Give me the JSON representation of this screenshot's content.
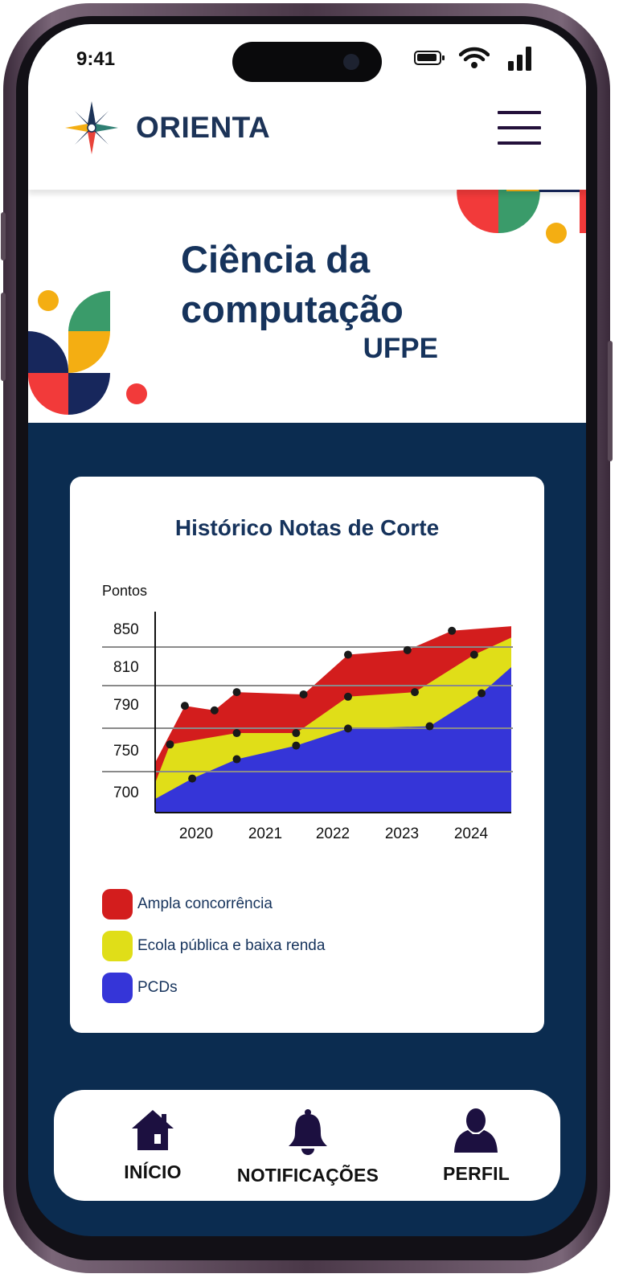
{
  "status_bar": {
    "time": "9:41"
  },
  "header": {
    "brand": "ORIENTA"
  },
  "hero": {
    "title_line1": "Ciência da",
    "title_line2": "computação",
    "subtitle": "UFPE"
  },
  "chart_card": {
    "chart_data": {
      "type": "area",
      "title": "Histórico Notas de Corte",
      "ylabel": "Pontos",
      "xlabel": "",
      "y_ticks": [
        "850",
        "810",
        "790",
        "750",
        "700"
      ],
      "x_ticks": [
        "2020",
        "2021",
        "2022",
        "2023",
        "2024"
      ],
      "legend_position": "bottom",
      "series": [
        {
          "name": "Ampla concorrência",
          "color": "#d31d1d",
          "points": [
            [
              2019.7,
              720
            ],
            [
              2020.1,
              770
            ],
            [
              2020.5,
              766
            ],
            [
              2020.8,
              782
            ],
            [
              2021.7,
              780
            ],
            [
              2022.3,
              815
            ],
            [
              2023.1,
              819
            ],
            [
              2023.7,
              836
            ],
            [
              2024.5,
              840
            ]
          ]
        },
        {
          "name": "Ecola pública e baixa renda",
          "color": "#e0de18",
          "points": [
            [
              2019.7,
              702
            ],
            [
              2019.9,
              736
            ],
            [
              2020.8,
              746
            ],
            [
              2021.6,
              746
            ],
            [
              2022.3,
              778
            ],
            [
              2023.2,
              782
            ],
            [
              2024.0,
              815
            ],
            [
              2024.5,
              830
            ]
          ]
        },
        {
          "name": "PCDs",
          "color": "#3535d8",
          "points": [
            [
              2019.7,
              688
            ],
            [
              2020.2,
              706
            ],
            [
              2020.8,
              723
            ],
            [
              2021.6,
              735
            ],
            [
              2022.3,
              750
            ],
            [
              2023.4,
              752
            ],
            [
              2024.1,
              781
            ],
            [
              2024.5,
              804
            ]
          ]
        }
      ]
    },
    "legend": [
      {
        "label": "Ampla concorrência",
        "color": "#d31d1d"
      },
      {
        "label": "Ecola pública e baixa renda",
        "color": "#e0de18"
      },
      {
        "label": "PCDs",
        "color": "#3535d8"
      }
    ]
  },
  "nav": {
    "home": "INÍCIO",
    "notifications": "NOTIFICAÇÕES",
    "profile": "PERFIL"
  },
  "colors": {
    "navy": "#0b2c50",
    "title_blue": "#16335c",
    "accent_red": "#f23a3a",
    "accent_green": "#3a9b6a",
    "accent_yellow": "#f4ae12",
    "accent_navy": "#17275c"
  }
}
